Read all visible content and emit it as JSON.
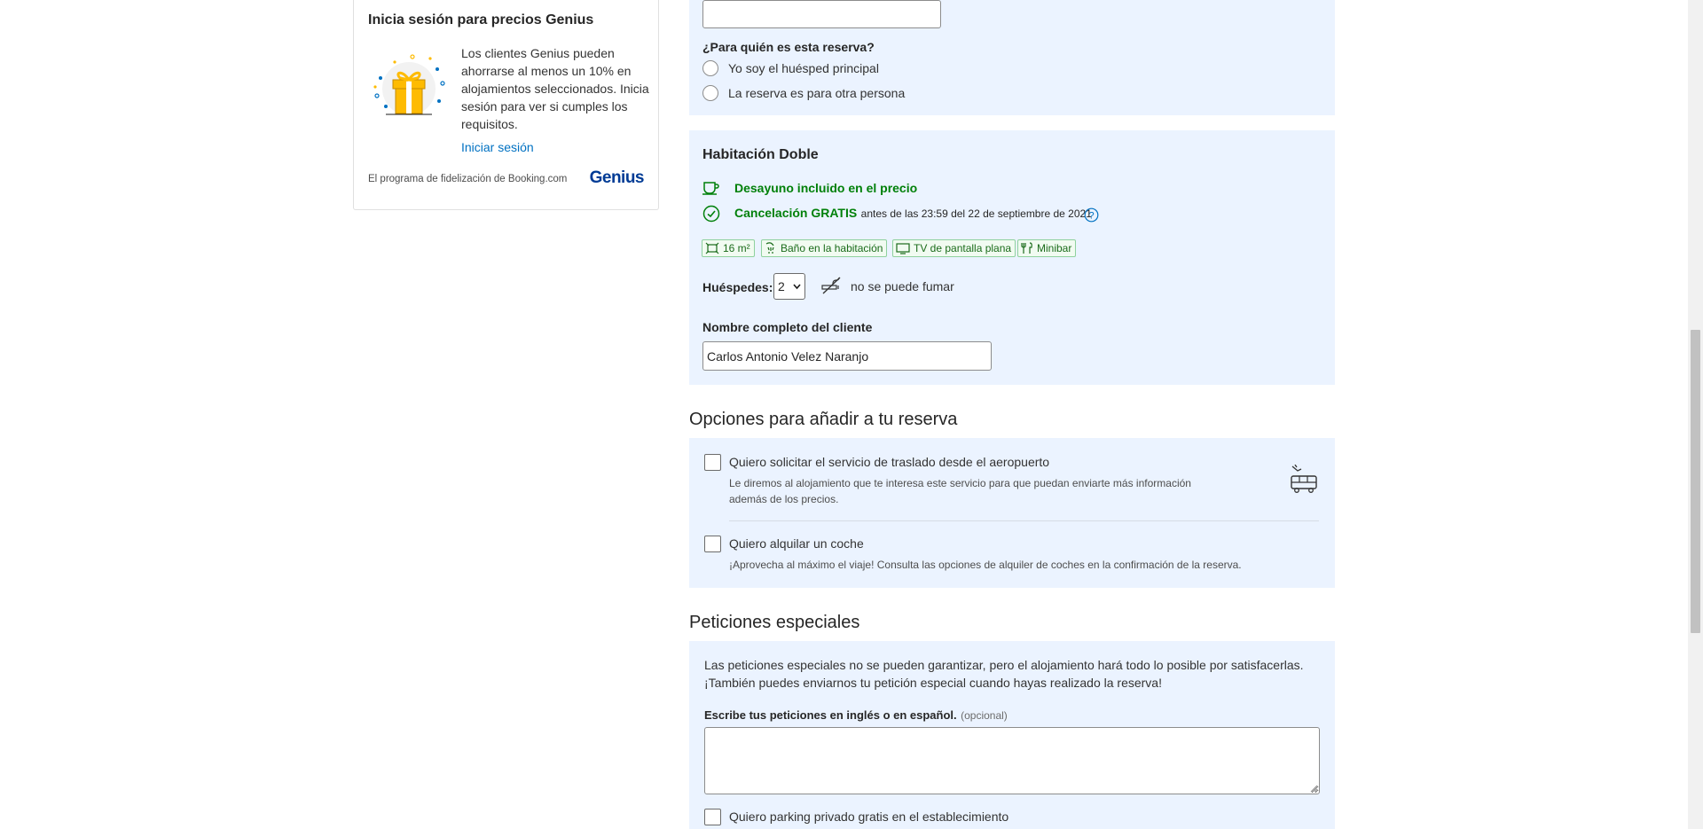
{
  "genius": {
    "title": "Inicia sesión para precios Genius",
    "description": "Los clientes Genius pueden ahorrarse al menos un 10% en alojamientos seleccionados. Inicia sesión para ver si cumples los requisitos.",
    "login_link": "Iniciar sesión",
    "footer": "El programa de fidelización de Booking.com",
    "logo": "Genius"
  },
  "guest_panel": {
    "top_input_value": "",
    "question": "¿Para quién es esta reserva?",
    "options": [
      "Yo soy el huésped principal",
      "La reserva es para otra persona"
    ]
  },
  "room": {
    "title": "Habitación Doble",
    "breakfast": "Desayuno incluido en el precio",
    "cancel_bold": "Cancelación GRATIS",
    "cancel_rest": "antes de las 23:59 del 22 de septiembre de 2021",
    "facilities": [
      "16 m²",
      "Baño en la habitación",
      "TV de pantalla plana",
      "Minibar"
    ],
    "guests_label": "Huéspedes:",
    "guests_value": "2",
    "smoking": "no se puede fumar",
    "name_label": "Nombre completo del cliente",
    "name_value": "Carlos Antonio Velez Naranjo"
  },
  "addons": {
    "title": "Opciones para añadir a tu reserva",
    "airport_label": "Quiero solicitar el servicio de traslado desde el aeropuerto",
    "airport_desc_1": "Le diremos al alojamiento que te interesa este servicio para que puedan enviarte más información",
    "airport_desc_2": "además de los precios.",
    "car_label": "Quiero alquilar un coche",
    "car_desc": "¡Aprovecha al máximo el viaje! Consulta las opciones de alquiler de coches en la confirmación de la reserva."
  },
  "special": {
    "title": "Peticiones especiales",
    "intro_1": "Las peticiones especiales no se pueden garantizar, pero el alojamiento hará todo lo posible por satisfacerlas.",
    "intro_2": "¡También puedes enviarnos tu petición especial cuando hayas realizado la reserva!",
    "field_label": "Escribe tus peticiones en inglés o en español.",
    "field_optional": "(opcional)",
    "textarea_value": "",
    "parking_label": "Quiero parking privado gratis en el establecimiento"
  },
  "colors": {
    "panel": "#ebf3ff",
    "green": "#008009",
    "link": "#0071c2",
    "genius_blue": "#003b95"
  }
}
